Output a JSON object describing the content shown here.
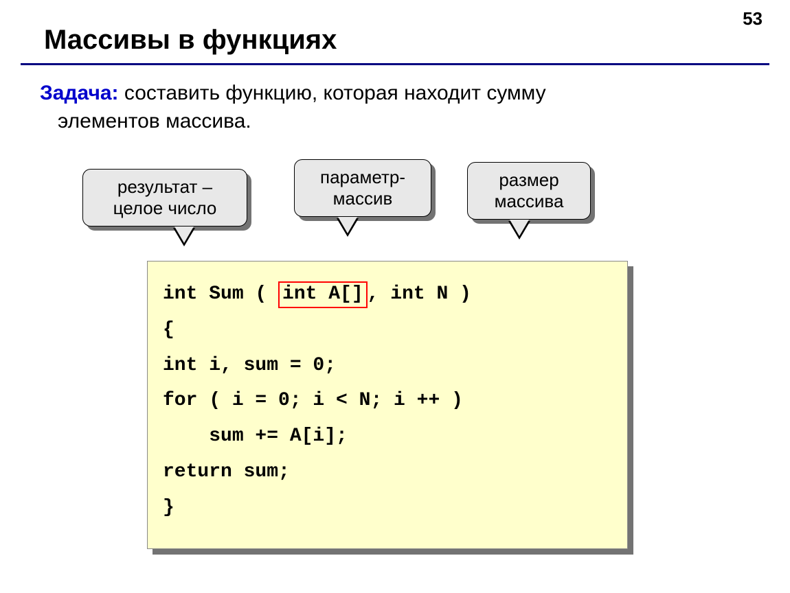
{
  "page_number": "53",
  "title": "Массивы в функциях",
  "task": {
    "label": "Задача:",
    "line1": " составить функцию, которая находит сумму",
    "line2": "элементов массива."
  },
  "callouts": {
    "result": {
      "line1": "результат –",
      "line2": "целое число"
    },
    "param": {
      "line1": "параметр-",
      "line2": "массив"
    },
    "size": {
      "line1": "размер",
      "line2": "массива"
    }
  },
  "code": {
    "l1a": "int Sum ( ",
    "l1b": "int A[]",
    "l1c": ", int N )",
    "l2": "{",
    "l3": "int i, sum = 0;",
    "l4": "for ( i = 0; i < N; i ++ )",
    "l5": "    sum += A[i];",
    "l6": "return sum;",
    "l7": "}"
  }
}
